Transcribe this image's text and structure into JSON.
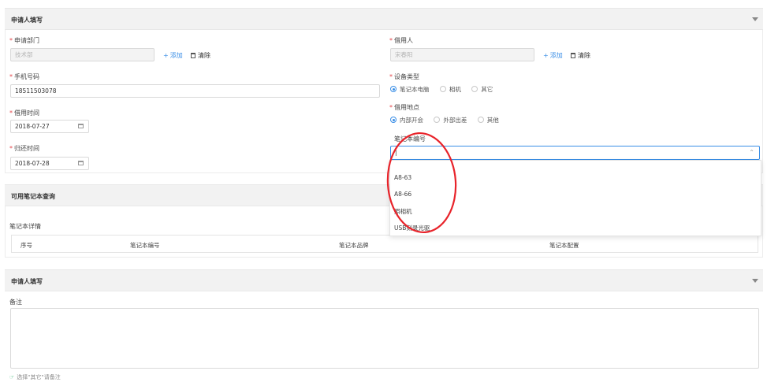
{
  "section1": {
    "title": "申请人填写",
    "dept": {
      "label": "申请部门",
      "value": "技术部",
      "add": "添加",
      "clear": "清除"
    },
    "borrower": {
      "label": "借用人",
      "value": "宋春阳",
      "add": "添加",
      "clear": "清除"
    },
    "phone": {
      "label": "手机号码",
      "value": "18511503078"
    },
    "device_type": {
      "label": "设备类型",
      "options": [
        "笔记本电脑",
        "相机",
        "其它"
      ],
      "selected": 0
    },
    "borrow_time": {
      "label": "借用时间",
      "value": "2018-07-27"
    },
    "location": {
      "label": "借用地点",
      "options": [
        "内部开会",
        "外部出差",
        "其他"
      ],
      "selected": 0
    },
    "notebook_no": {
      "label": "笔记本编号",
      "value": "|"
    },
    "return_time": {
      "label": "归还时间",
      "value": "2018-07-28"
    }
  },
  "dropdown": {
    "items": [
      "A8-63",
      "A8-66",
      "照相机",
      "USB刻录光驱"
    ]
  },
  "section2": {
    "title": "可用笔记本查询",
    "details_label": "笔记本详情",
    "columns": [
      "序号",
      "笔记本编号",
      "笔记本品牌",
      "笔记本配置"
    ]
  },
  "section3": {
    "title": "申请人填写",
    "remark_label": "备注",
    "hint": "选择\"其它\"请备注"
  },
  "colors": {
    "accent": "#3a8ee6",
    "required": "#e5484d",
    "annotation": "#e8232a"
  }
}
